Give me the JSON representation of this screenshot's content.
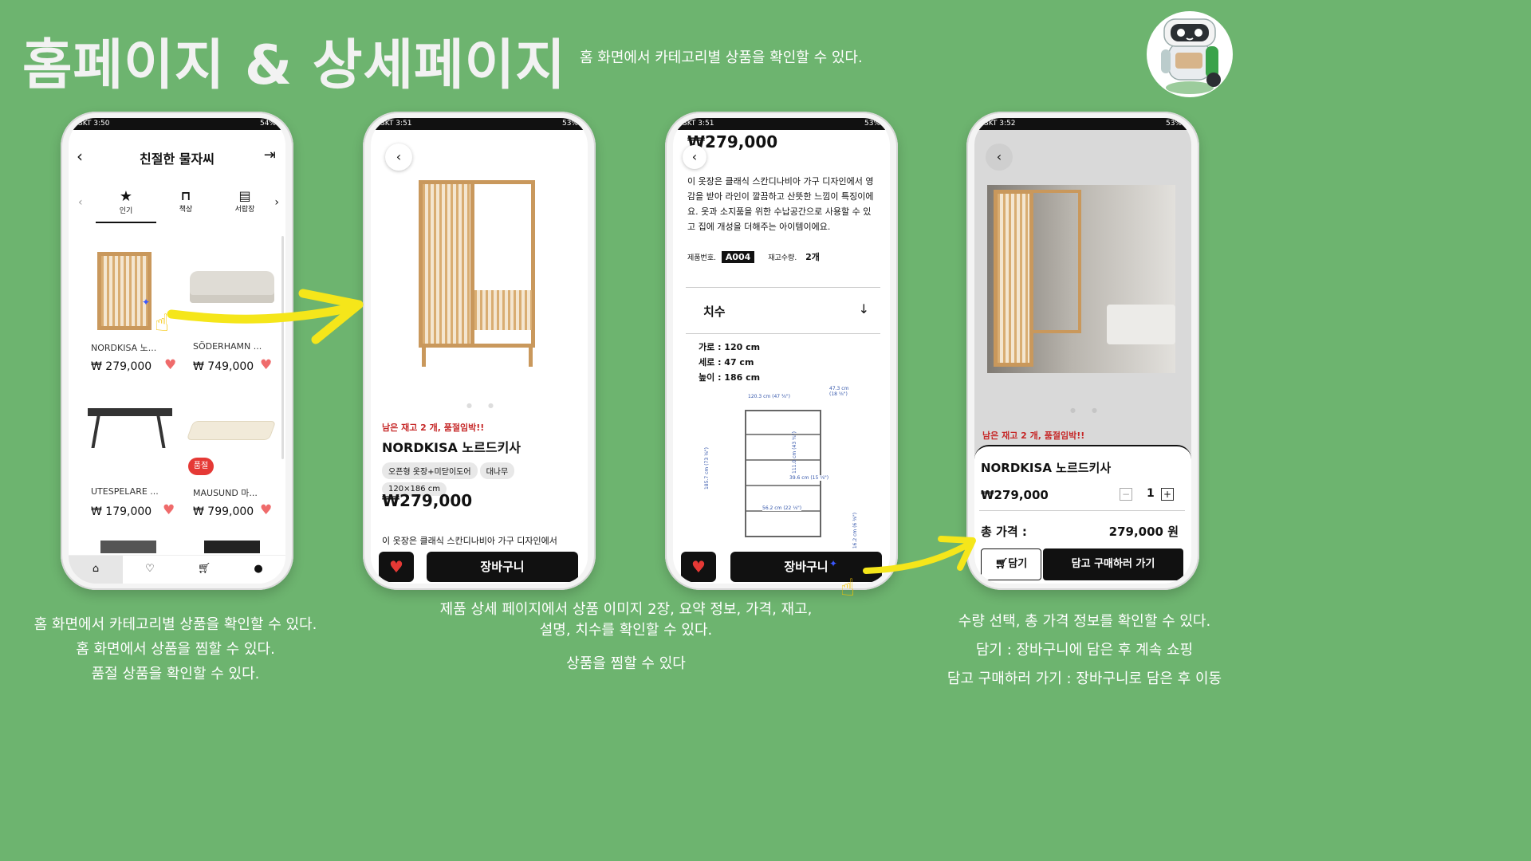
{
  "title": "홈페이지 & 상세페이지",
  "subtitle": "홈 화면에서 카테고리별 상품을 확인할 수 있다.",
  "colors": {
    "background": "#6db46f",
    "accent_red": "#e53935",
    "arrow_yellow": "#f5e61a"
  },
  "phone1": {
    "status_left": "SKT 3:50",
    "status_right": "54%",
    "header_title": "친절한 물자씨",
    "categories": [
      {
        "icon": "star-icon",
        "label": "인기"
      },
      {
        "icon": "desk-icon",
        "label": "책상"
      },
      {
        "icon": "drawer-icon",
        "label": "서랍장"
      }
    ],
    "products": [
      {
        "name": "NORDKISA 노...",
        "price": "₩ 279,000"
      },
      {
        "name": "SÖDERHAMN ...",
        "price": "₩ 749,000"
      },
      {
        "name": "UTESPELARE ...",
        "price": "₩ 179,000"
      },
      {
        "name": "MAUSUND 마...",
        "price": "₩ 799,000",
        "badge": "품절"
      }
    ],
    "nav": [
      "home-icon",
      "heart-icon",
      "cart-icon",
      "user-icon"
    ]
  },
  "phone2": {
    "status_left": "SKT 3:51",
    "status_right": "53%",
    "stock_warning": "남은 재고 2 개, 품절임박!!",
    "product_name": "NORDKISA 노르드키사",
    "tags": [
      "오픈형 옷장+미닫이도어",
      "대나무",
      "120×186 cm"
    ],
    "price": "₩279,000",
    "description_snippet": "이 옷장은 클래식 스칸디나비아 가구 디자인에서",
    "cart_button": "장바구니"
  },
  "phone3": {
    "status_left": "SKT 3:51",
    "status_right": "53%",
    "price": "₩279,000",
    "description": "이 옷장은 클래식 스칸디나비아 가구 디자인에서 영감을 받아 라인이 깔끔하고 산뜻한 느낌이 특징이에요. 옷과 소지품을 위한 수납공간으로 사용할 수 있고 집에 개성을 더해주는 아이템이에요.",
    "product_no_label": "제품번호.",
    "product_no": "A004",
    "stock_label": "재고수량.",
    "stock_value": "2개",
    "dimension_title": "치수",
    "dims": [
      "가로 : 120 cm",
      "세로 : 47 cm",
      "높이 : 186 cm"
    ],
    "diagram_labels": [
      "120.3 cm (47 ⅜\")",
      "47.3 cm (18 ⅝\")",
      "185.7 cm (73 ⅛\")",
      "111.0 cm (43 ¾\")",
      "39.6 cm (15 ⅝\")",
      "56.2 cm (22 ⅛\")",
      "16.2 cm (6 ⅜\")"
    ],
    "cart_button": "장바구니"
  },
  "phone4": {
    "status_left": "SKT 3:52",
    "status_right": "53%",
    "stock_warning": "남은 재고 2 개, 품절임박!!",
    "product_name": "NORDKISA 노르드키사",
    "price": "₩279,000",
    "quantity": "1",
    "total_label": "총 가격 :",
    "total_value": "279,000 원",
    "add_button": "담기",
    "buy_button": "담고 구매하러 가기"
  },
  "captions": {
    "left": [
      "홈 화면에서 카테고리별 상품을 확인할 수 있다.",
      "홈 화면에서 상품을 찜할 수 있다.",
      "품절 상품을 확인할 수 있다."
    ],
    "middle": [
      "제품 상세 페이지에서 상품 이미지 2장, 요약 정보, 가격, 재고,",
      "설명, 치수를 확인할 수 있다.",
      "상품을 찜할 수 있다"
    ],
    "right": [
      "수량 선택, 총 가격 정보를 확인할 수 있다.",
      "담기 : 장바구니에 담은 후 계속 쇼핑",
      "담고 구매하러 가기 : 장바구니로 담은 후 이동"
    ]
  }
}
